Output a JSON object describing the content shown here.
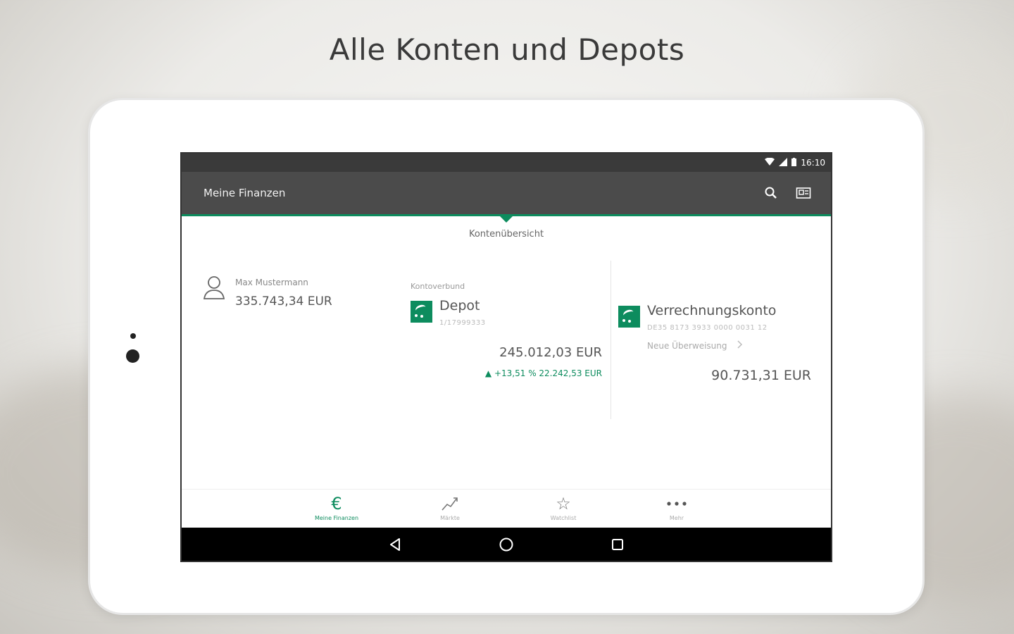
{
  "headline": "Alle Konten und Depots",
  "colors": {
    "accent": "#0d8c5e",
    "appbar": "#4b4b4b",
    "statusbar": "#3a3a3a"
  },
  "statusbar": {
    "time": "16:10",
    "icons": [
      "wifi-icon",
      "signal-icon",
      "battery-icon"
    ]
  },
  "appbar": {
    "title": "Meine Finanzen",
    "actions": [
      "search-icon",
      "postbox-icon"
    ]
  },
  "section": {
    "label": "Kontenübersicht"
  },
  "person": {
    "name": "Max Mustermann",
    "total": "335.743,34 EUR"
  },
  "depot": {
    "group_label": "Kontoverbund",
    "name": "Depot",
    "number": "1/17999333",
    "value": "245.012,03 EUR",
    "change": "+13,51 %  22.242,53 EUR"
  },
  "verrechnungskonto": {
    "name": "Verrechnungskonto",
    "number": "DE35 8173 3933 0000 0031 12",
    "transfer_label": "Neue Überweisung",
    "value": "90.731,31 EUR"
  },
  "bottom_nav": [
    {
      "label": "Meine Finanzen",
      "icon": "euro-icon",
      "active": true
    },
    {
      "label": "Märkte",
      "icon": "chart-icon",
      "active": false
    },
    {
      "label": "Watchlist",
      "icon": "star-icon",
      "active": false
    },
    {
      "label": "Mehr",
      "icon": "more-icon",
      "active": false
    }
  ],
  "system_nav": [
    "back-icon",
    "home-icon",
    "recents-icon"
  ]
}
